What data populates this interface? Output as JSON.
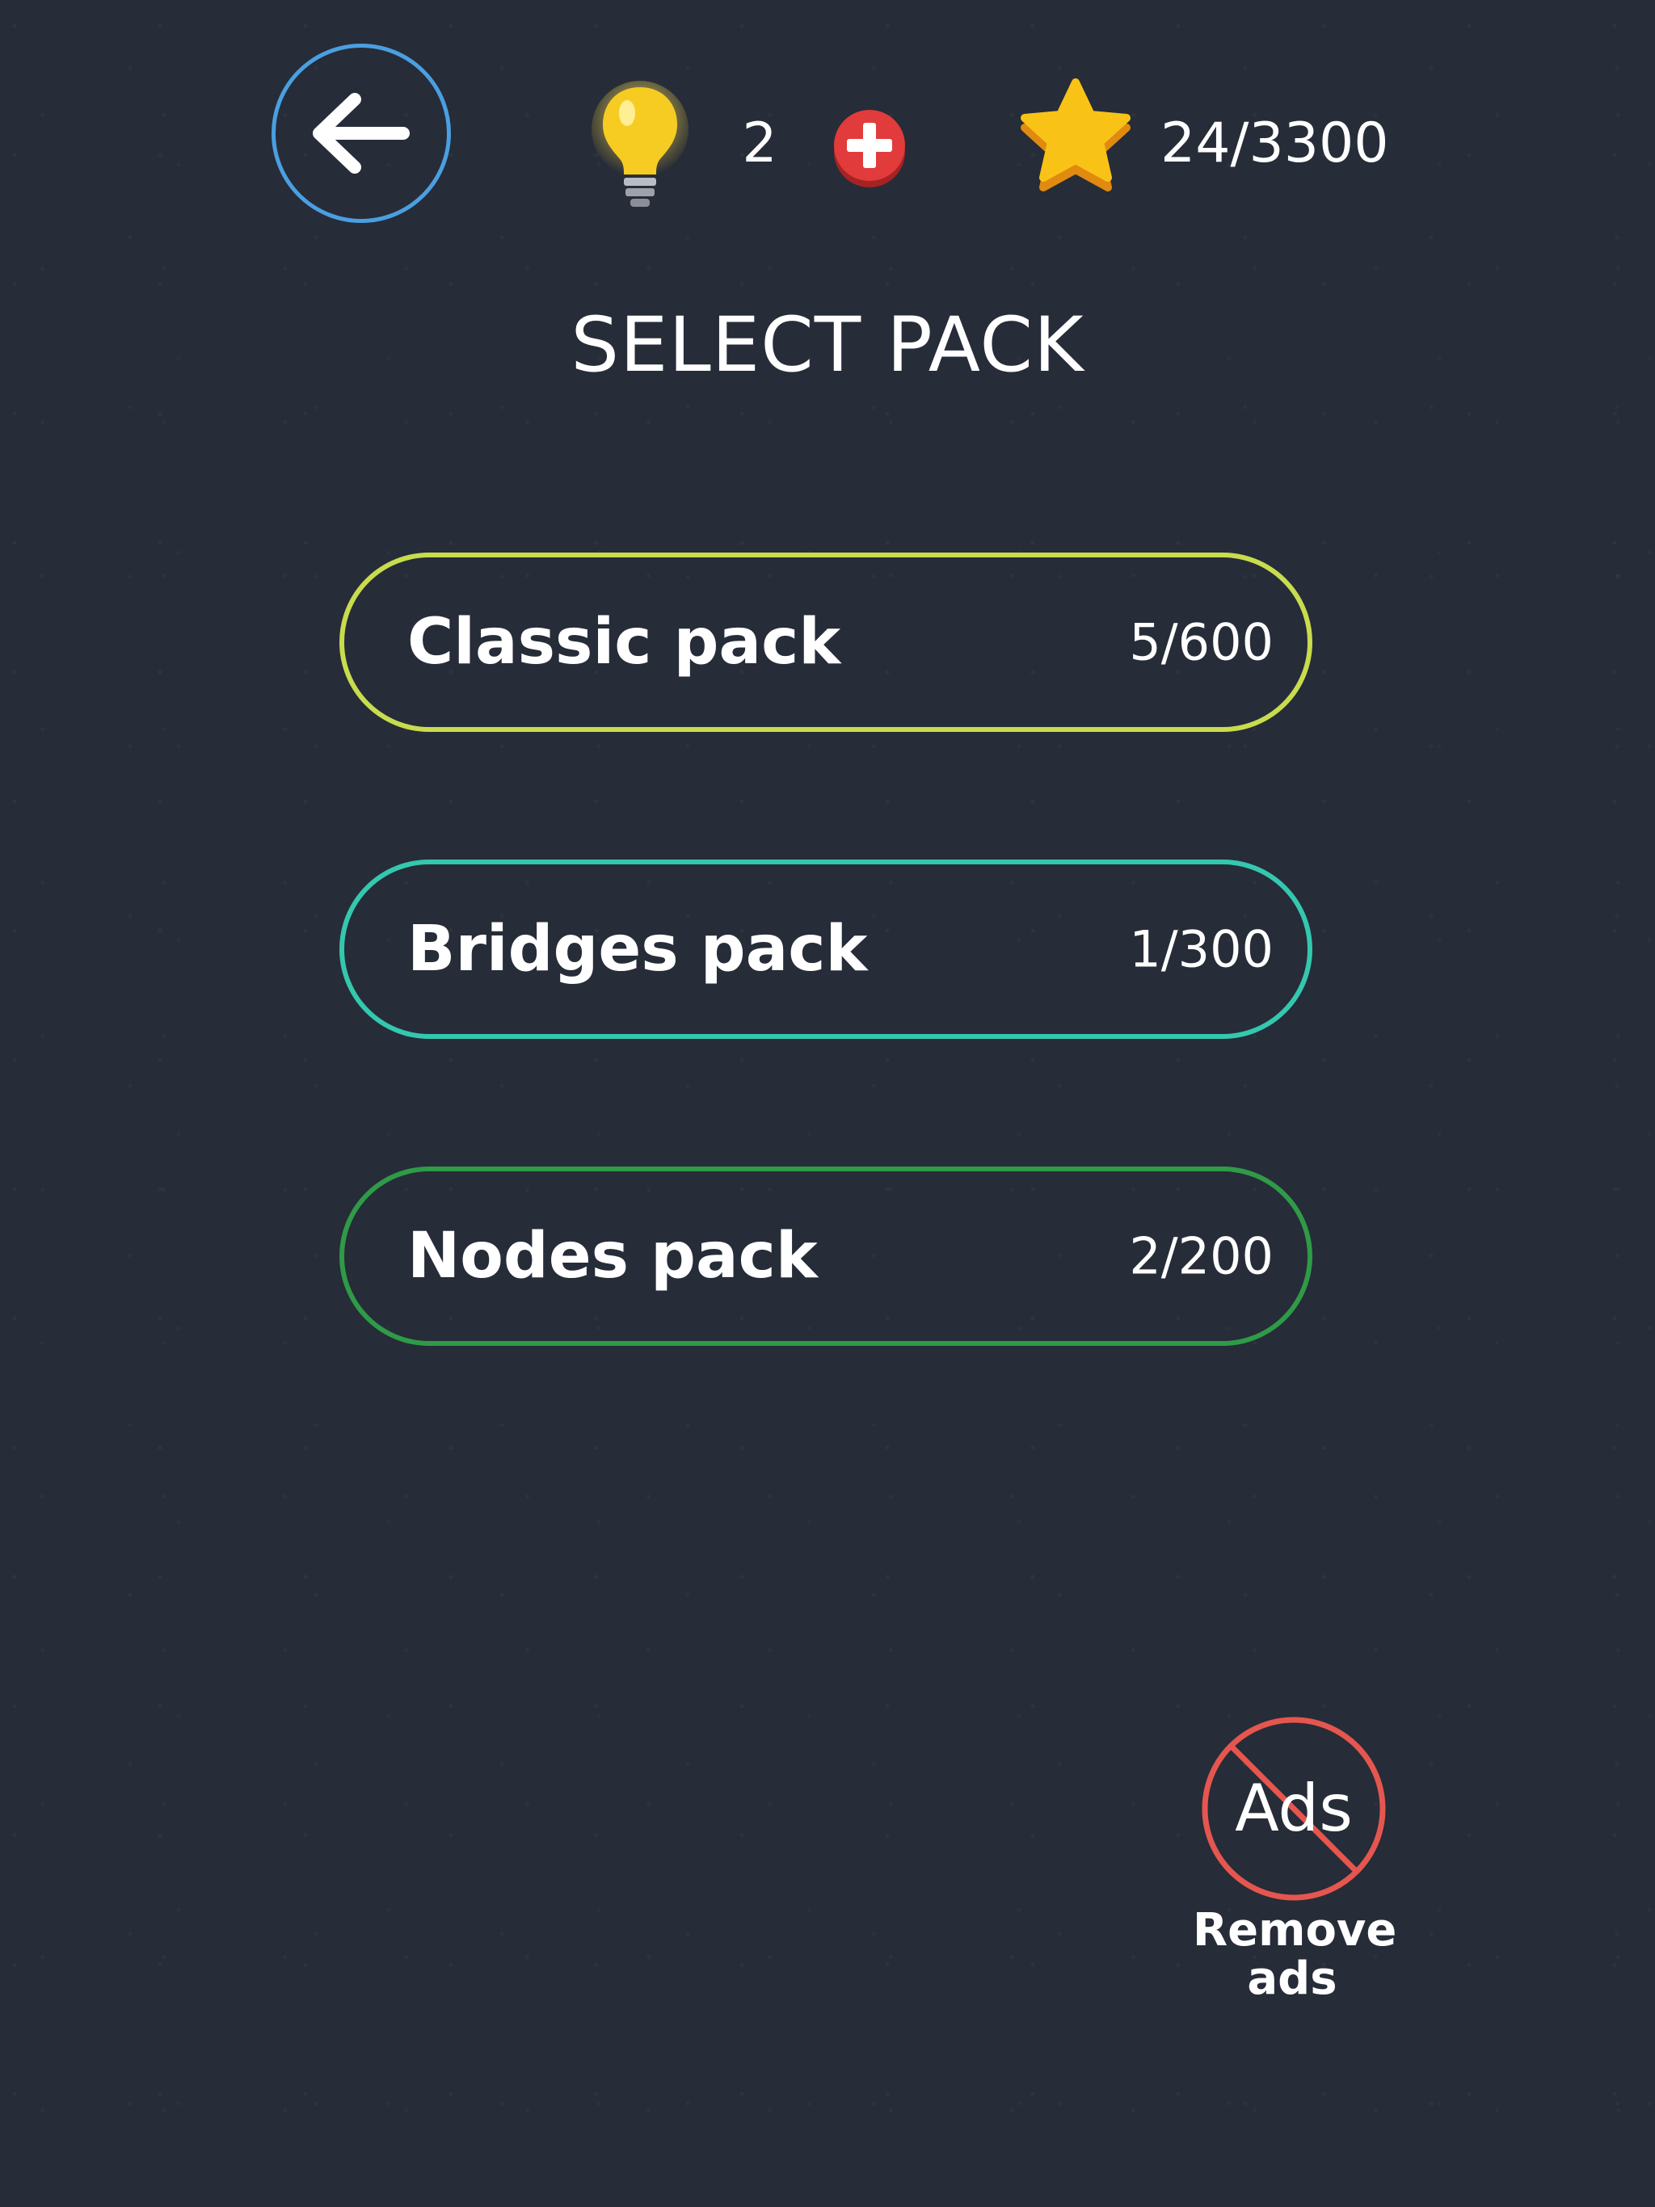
{
  "header": {
    "hints_count": "2",
    "stars_progress": "24/3300"
  },
  "title": "SELECT PACK",
  "packs": [
    {
      "name": "Classic pack",
      "progress": "5/600",
      "color": "#c8dc4e"
    },
    {
      "name": "Bridges pack",
      "progress": "1/300",
      "color": "#34c8ae"
    },
    {
      "name": "Nodes pack",
      "progress": "2/200",
      "color": "#2f9a47"
    }
  ],
  "remove_ads": {
    "icon_text": "Ads",
    "label_line1": "Remove",
    "label_line2": "ads"
  },
  "colors": {
    "background": "#262c38",
    "back_button_ring": "#4a9fe0",
    "hint_bulb": "#f7cc22",
    "add_button": "#e23b3b",
    "star": "#f8c316",
    "no_ads_ring": "#e5564f"
  },
  "icons": {
    "back": "arrow-left-icon",
    "hints": "light-bulb-icon",
    "add": "plus-icon",
    "stars": "star-icon",
    "no_ads": "no-ads-icon"
  }
}
